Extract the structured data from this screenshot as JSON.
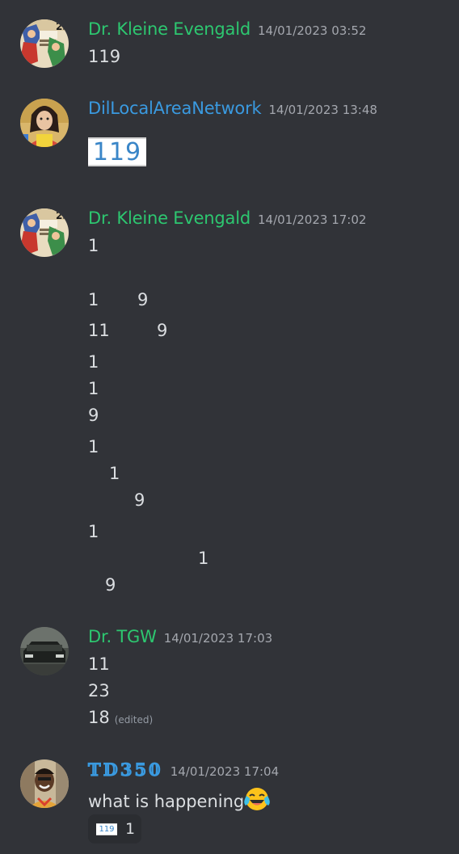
{
  "messages": [
    {
      "author": "Dr. Kleine Evengald",
      "timestamp": "14/01/2023 03:52",
      "lines": [
        "119"
      ]
    },
    {
      "author": "DilLocalAreaNetwork",
      "timestamp": "14/01/2023 13:48",
      "emoji_text": "119"
    },
    {
      "author": "Dr. Kleine Evengald",
      "timestamp": "14/01/2023 17:02",
      "lines": [
        "1",
        "1",
        "9",
        "11",
        "9",
        "1",
        "1",
        "9",
        "1",
        "1",
        "9",
        "1",
        "1",
        "9"
      ]
    },
    {
      "author": "Dr. TGW",
      "timestamp": "14/01/2023 17:03",
      "lines": [
        "11",
        "23",
        "18"
      ],
      "edited_label": "(edited)"
    },
    {
      "author": "𝕋𝔻𝟛𝟝𝟘",
      "timestamp": "14/01/2023 17:04",
      "lines": [
        "what is happening"
      ],
      "reaction": {
        "emoji_text": "119",
        "count": "1"
      }
    }
  ],
  "colors": {
    "background": "#313338",
    "name_green": "#2dc770",
    "name_blue": "#3a9ae0",
    "text": "#dbdee1",
    "timestamp": "#a4a7ae"
  }
}
